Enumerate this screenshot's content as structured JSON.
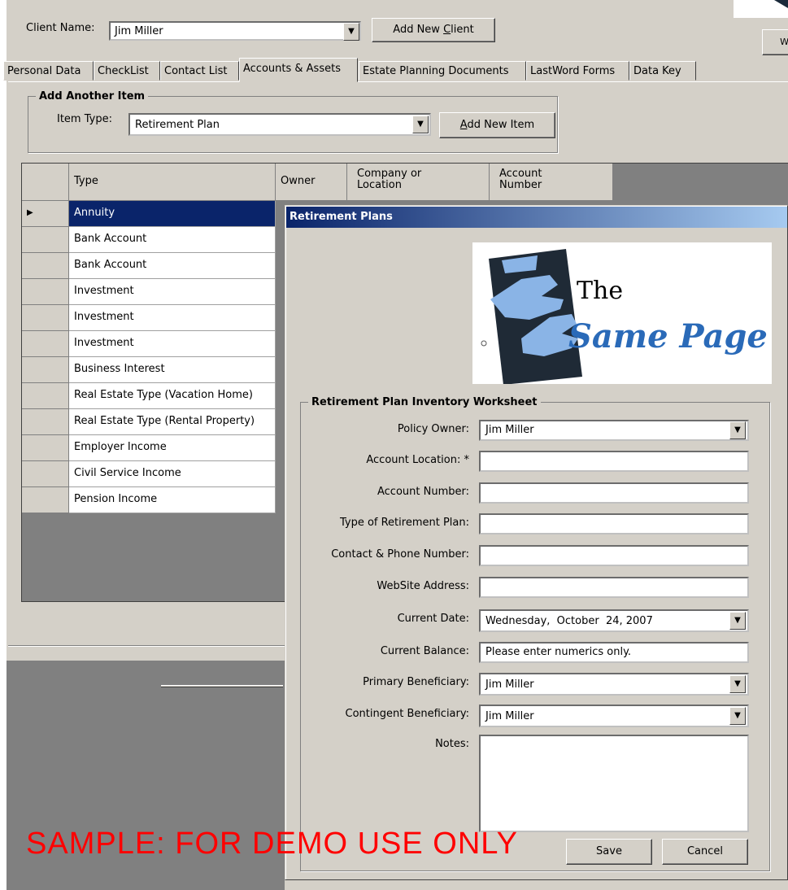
{
  "client": {
    "label": "Client Name:",
    "value": "Jim Miller",
    "add_button": "Add New Client",
    "add_button_underline": "C"
  },
  "tabs": [
    {
      "label": "Personal Data"
    },
    {
      "label": "CheckList"
    },
    {
      "label": "Contact List"
    },
    {
      "label": "Accounts & Assets"
    },
    {
      "label": "Estate Planning Documents"
    },
    {
      "label": "LastWord Forms"
    },
    {
      "label": "Data Key"
    }
  ],
  "add_item": {
    "title": "Add Another Item",
    "type_label": "Item Type:",
    "type_value": "Retirement Plan",
    "add_button": "Add New Item"
  },
  "grid": {
    "headers": {
      "type": "Type",
      "owner": "Owner",
      "company": "Company or Location",
      "account": "Account Number"
    },
    "rows": [
      {
        "type": "Annuity",
        "selected": true
      },
      {
        "type": "Bank Account"
      },
      {
        "type": "Bank Account"
      },
      {
        "type": "Investment"
      },
      {
        "type": "Investment"
      },
      {
        "type": "Investment"
      },
      {
        "type": "Business Interest"
      },
      {
        "type": "Real Estate Type (Vacation Home)"
      },
      {
        "type": "Real Estate Type (Rental Property)"
      },
      {
        "type": "Employer Income"
      },
      {
        "type": "Civil Service Income"
      },
      {
        "type": "Pension Income"
      }
    ]
  },
  "dialog": {
    "title": "Retirement Plans",
    "logo": {
      "the": "The",
      "name": "Same Page"
    },
    "worksheet_title": "Retirement Plan Inventory Worksheet",
    "fields": {
      "policy_owner": {
        "label": "Policy Owner:",
        "value": "Jim Miller"
      },
      "account_location": {
        "label": "Account Location: *",
        "value": ""
      },
      "account_number": {
        "label": "Account Number:",
        "value": ""
      },
      "plan_type": {
        "label": "Type of Retirement Plan:",
        "value": ""
      },
      "contact_phone": {
        "label": "Contact & Phone Number:",
        "value": ""
      },
      "website": {
        "label": "WebSite Address:",
        "value": ""
      },
      "current_date": {
        "label": "Current  Date:",
        "value": "Wednesday,  October  24, 2007"
      },
      "current_balance": {
        "label": "Current  Balance:",
        "value": "Please enter numerics only."
      },
      "primary_beneficiary": {
        "label": "Primary Beneficiary:",
        "value": "Jim Miller"
      },
      "contingent_beneficiary": {
        "label": "Contingent Beneficiary:",
        "value": "Jim Miller"
      },
      "notes": {
        "label": "Notes:",
        "value": ""
      }
    },
    "save_button": "Save",
    "cancel_button": "Cancel"
  },
  "corner_button_text": "W",
  "watermark": "SAMPLE: FOR DEMO USE ONLY",
  "colors": {
    "selection": "#0a246a",
    "titlebar": "#0a246a",
    "watermark": "#ff0000",
    "logo_blue": "#2a6ab8",
    "logo_light": "#8ab4e6"
  }
}
